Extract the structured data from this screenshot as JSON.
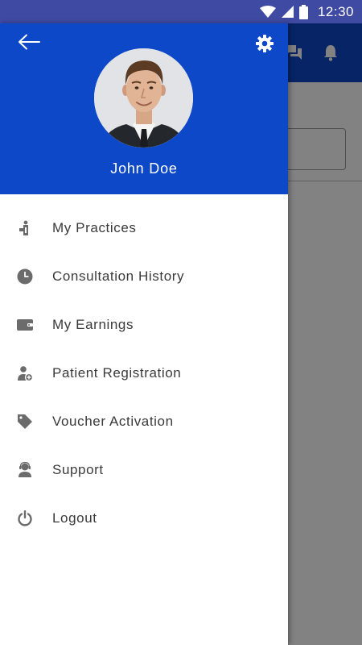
{
  "status_bar": {
    "time": "12:30"
  },
  "drawer": {
    "user_name": "John Doe",
    "menu": [
      {
        "label": "My Practices",
        "icon": "doctor-practice-icon"
      },
      {
        "label": "Consultation History",
        "icon": "clock-icon"
      },
      {
        "label": "My Earnings",
        "icon": "wallet-icon"
      },
      {
        "label": "Patient Registration",
        "icon": "add-person-icon"
      },
      {
        "label": "Voucher Activation",
        "icon": "tag-icon"
      },
      {
        "label": "Support",
        "icon": "support-agent-icon"
      },
      {
        "label": "Logout",
        "icon": "power-icon"
      }
    ]
  },
  "colors": {
    "primary": "#0c48c8",
    "status_bar": "#3f4aa3",
    "scrim": "rgba(0,0,0,0.49)",
    "icon": "#6b6b6b",
    "text": "#3a3a3a"
  }
}
